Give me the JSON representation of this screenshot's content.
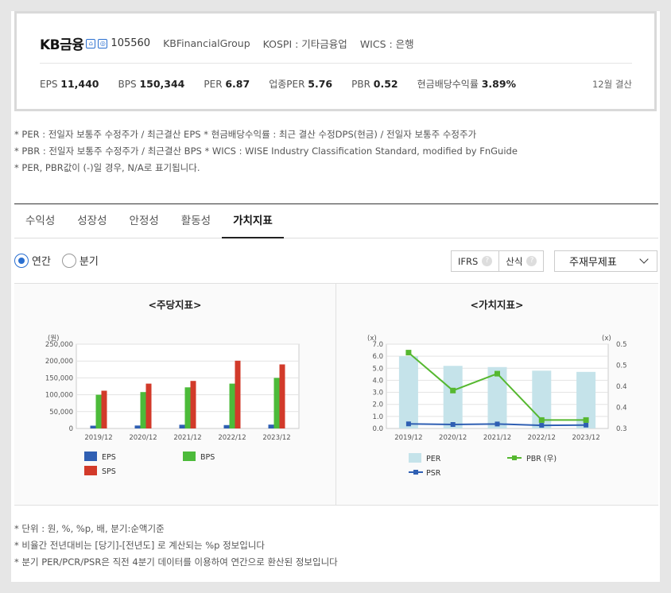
{
  "header": {
    "company": "KB금융",
    "icons": [
      "home-icon",
      "globe-icon"
    ],
    "code": "105560",
    "eng_name": "KBFinancialGroup",
    "market": "KOSPI : 기타금융업",
    "wics": "WICS : 은행",
    "stats": [
      {
        "label": "EPS",
        "value": "11,440"
      },
      {
        "label": "BPS",
        "value": "150,344"
      },
      {
        "label": "PER",
        "value": "6.87"
      },
      {
        "label": "업종PER",
        "value": "5.76"
      },
      {
        "label": "PBR",
        "value": "0.52"
      },
      {
        "label": "현금배당수익률",
        "value": "3.89%"
      }
    ],
    "fiscal": "12월 결산"
  },
  "notes_top": [
    "* PER : 전일자 보통주 수정주가 / 최근결산 EPS * 현금배당수익률 : 최근 결산 수정DPS(현금) / 전일자 보통주 수정주가",
    "* PBR : 전일자 보통주 수정주가 / 최근결산 BPS * WICS : WISE Industry Classification Standard, modified by FnGuide",
    "* PER, PBR값이 (-)일 경우, N/A로 표기됩니다."
  ],
  "tabs": [
    "수익성",
    "성장성",
    "안정성",
    "활동성",
    "가치지표"
  ],
  "active_tab": 4,
  "period": {
    "options": [
      "연간",
      "분기"
    ],
    "selected": 0
  },
  "options": {
    "ifrs": "IFRS",
    "calc": "산식",
    "help": "?"
  },
  "statement_select": "주재무제표",
  "colors": {
    "eps": "#2f5fb3",
    "bps": "#4cbb3a",
    "sps": "#d23a2a",
    "per": "#c5e3ea",
    "pbr": "#56b830",
    "psr": "#2f5fb3",
    "active_radio": "#2a6fd0"
  },
  "chart_data": [
    {
      "type": "bar",
      "title": "<주당지표>",
      "unit_label": "(원)",
      "categories": [
        "2019/12",
        "2020/12",
        "2021/12",
        "2022/12",
        "2023/12"
      ],
      "ylim": [
        0,
        250000
      ],
      "yticks": [
        "0",
        "50,000",
        "100,000",
        "150,000",
        "200,000",
        "250,000"
      ],
      "grid": true,
      "legend_position": "bottom",
      "series": [
        {
          "name": "EPS",
          "values": [
            8200,
            8700,
            11000,
            10000,
            11400
          ]
        },
        {
          "name": "BPS",
          "values": [
            100000,
            108000,
            122000,
            133000,
            150000
          ]
        },
        {
          "name": "SPS",
          "values": [
            112000,
            133000,
            141000,
            201000,
            190000
          ]
        }
      ]
    },
    {
      "type": "bar",
      "title": "<가치지표>",
      "unit_label_left": "(x)",
      "unit_label_right": "(x)",
      "categories": [
        "2019/12",
        "2020/12",
        "2021/12",
        "2022/12",
        "2023/12"
      ],
      "ylim": [
        0,
        7.0
      ],
      "yticks": [
        "0.0",
        "1.0",
        "2.0",
        "3.0",
        "4.0",
        "5.0",
        "6.0",
        "7.0"
      ],
      "y2lim": [
        0.3,
        0.5
      ],
      "y2ticks": [
        "0.3",
        "0.4",
        "0.4",
        "0.5",
        "0.5"
      ],
      "grid": true,
      "legend_position": "bottom",
      "series": [
        {
          "name": "PER",
          "kind": "bar",
          "values": [
            6.0,
            5.2,
            5.1,
            4.8,
            4.7
          ]
        },
        {
          "name": "PBR (우)",
          "kind": "line",
          "axis": "right",
          "values": [
            0.48,
            0.39,
            0.43,
            0.32,
            0.32
          ]
        },
        {
          "name": "PSR",
          "kind": "line",
          "values": [
            0.38,
            0.33,
            0.37,
            0.26,
            0.28
          ]
        }
      ]
    }
  ],
  "notes_bottom": [
    "* 단위 : 원, %, %p, 배, 분기:순액기준",
    "* 비율간 전년대비는 [당기]-[전년도] 로 계산되는 %p 정보입니다",
    "* 분기 PER/PCR/PSR은 직전 4분기 데이터를 이용하여 연간으로 환산된 정보입니다"
  ]
}
